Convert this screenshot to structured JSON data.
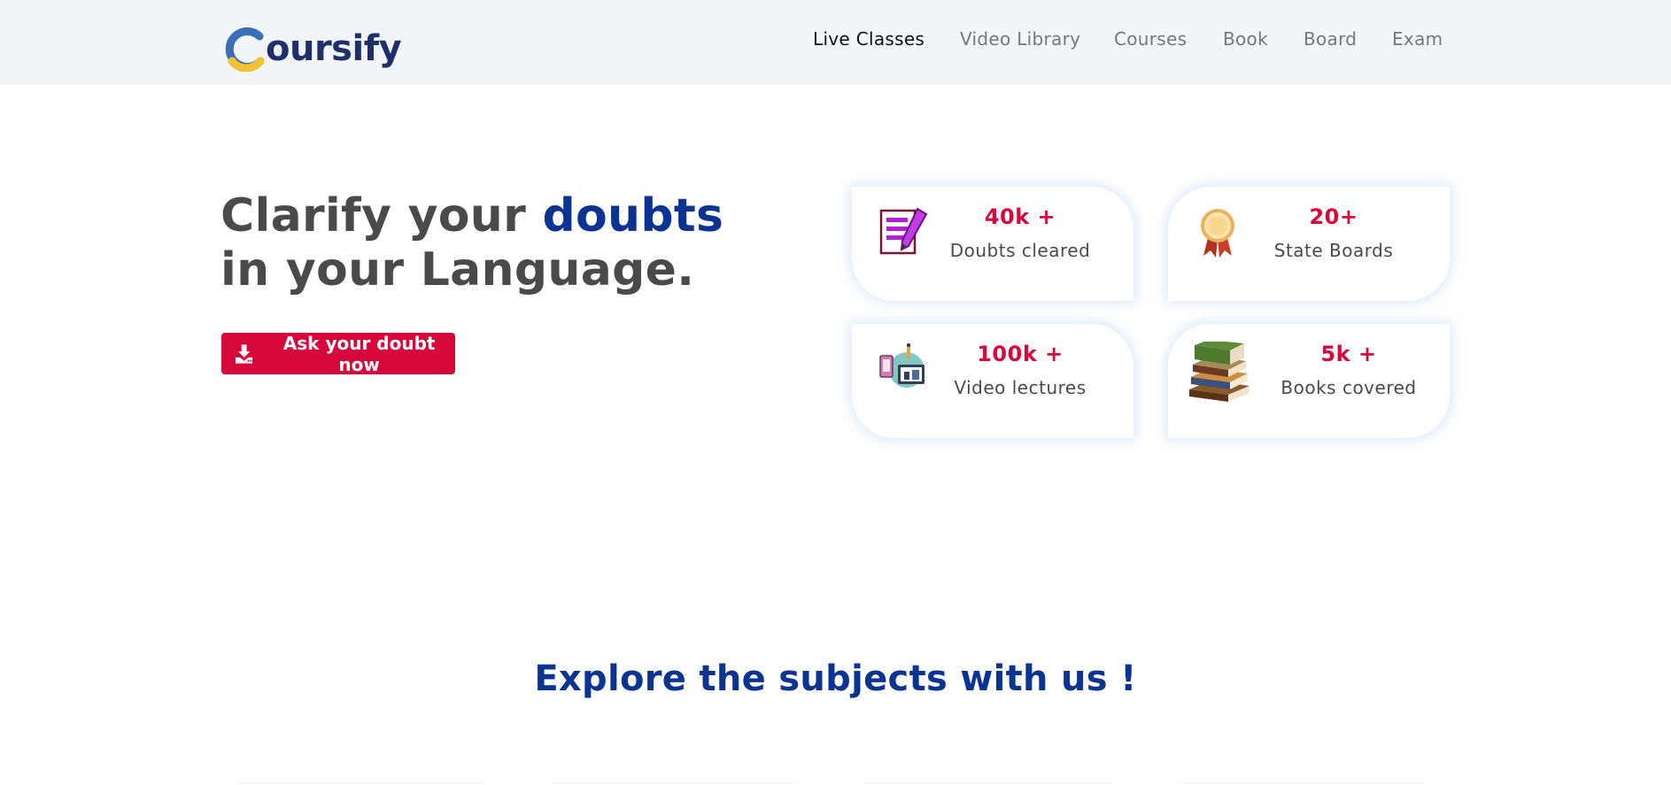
{
  "brand": {
    "name": "oursify",
    "logo_letter": "C"
  },
  "nav": {
    "items": [
      {
        "label": "Live Classes",
        "active": true
      },
      {
        "label": "Video Library",
        "active": false
      },
      {
        "label": "Courses",
        "active": false
      },
      {
        "label": "Book",
        "active": false
      },
      {
        "label": "Board",
        "active": false
      },
      {
        "label": "Exam",
        "active": false
      }
    ]
  },
  "hero": {
    "line1_prefix": "Clarify your ",
    "line1_accent": "doubts",
    "line2": "in your Language.",
    "cta_label": "Ask your doubt now",
    "cta_icon": "download-icon"
  },
  "stats": [
    {
      "value": "40k +",
      "label": "Doubts cleared",
      "icon": "notepad-pen-icon"
    },
    {
      "value": "20+",
      "label": "State Boards",
      "icon": "award-ribbon-icon"
    },
    {
      "value": "100k +",
      "label": "Video lectures",
      "icon": "video-lecture-icon"
    },
    {
      "value": "5k +",
      "label": "Books covered",
      "icon": "books-stack-icon"
    }
  ],
  "section": {
    "title": "Explore the subjects with us !"
  },
  "colors": {
    "primary_blue": "#0b3391",
    "brand_navy": "#1f2f6a",
    "accent_red": "#d6083b",
    "header_bg": "#f3f6f9",
    "text_gray": "#4a4a4a",
    "nav_gray": "#777777"
  }
}
